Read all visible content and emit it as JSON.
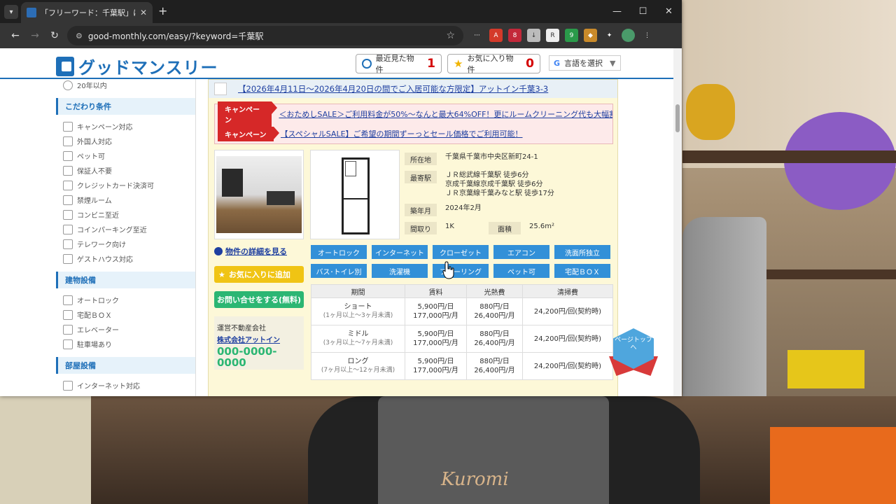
{
  "browser": {
    "tab_title": "「フリーワード：千葉駅」に該当した",
    "url": "good-monthly.com/easy/?keyword=千葉駅",
    "extensions": [
      "···",
      "A",
      "8",
      "↓",
      "R",
      "9",
      "◆",
      "✦"
    ]
  },
  "header": {
    "logo_text": "グッドマンスリー",
    "recent_label": "最近見た物件",
    "recent_count": "1",
    "fav_label": "お気に入り物件",
    "fav_count": "0",
    "lang_label": "言語を選択"
  },
  "sidebar": {
    "radio_label": "20年以内",
    "sections": [
      {
        "title": "こだわり条件",
        "items": [
          "キャンペーン対応",
          "外国人対応",
          "ペット可",
          "保証人不要",
          "クレジットカード決済可",
          "禁煙ルーム",
          "コンビニ至近",
          "コインパーキング至近",
          "テレワーク向け",
          "ゲストハウス対応"
        ]
      },
      {
        "title": "建物設備",
        "items": [
          "オートロック",
          "宅配ＢＯＸ",
          "エレベーター",
          "駐車場あり"
        ]
      },
      {
        "title": "部屋設備",
        "items": [
          "インターネット対応"
        ]
      }
    ]
  },
  "property": {
    "title": "【2026年4月11日～2026年4月20日の間でご入居可能な方限定】アットイン千葉3-3",
    "campaigns": [
      {
        "tag": "キャンペーン",
        "text": "＜おためしSALE＞ご利用料金が50%～なんと最大64%OFF！更にルームクリーニング代も大幅割…"
      },
      {
        "tag": "キャンペーン",
        "text": "【スペシャルSALE】ご希望の期間ずーっとセール価格でご利用可能！"
      }
    ],
    "info": {
      "address_label": "所在地",
      "address": "千葉県千葉市中央区新町24-1",
      "station_label": "最寄駅",
      "stations": [
        "ＪＲ総武線千葉駅 徒歩6分",
        "京成千葉線京成千葉駅 徒歩6分",
        "ＪＲ京葉線千葉みなと駅 徒歩17分"
      ],
      "built_label": "築年月",
      "built": "2024年2月",
      "layout_label": "間取り",
      "layout": "1K",
      "area_label": "面積",
      "area": "25.6m²"
    },
    "detail_link": "物件の詳細を見る",
    "fav_button": "お気に入りに追加",
    "inquiry_button": "お問い合せをする(無料)",
    "agency_label": "運営不動産会社",
    "agency_name": "株式会社アットイン",
    "agency_tel": "000-0000-0000",
    "tags": [
      "オートロック",
      "インターネット",
      "クローゼット",
      "エアコン",
      "洗面所独立",
      "バス･トイレ別",
      "洗濯機",
      "フローリング",
      "ペット可",
      "宅配ＢＯＸ"
    ],
    "price_headers": [
      "期間",
      "賃料",
      "光熱費",
      "清掃費"
    ],
    "prices": [
      {
        "period": "ショート",
        "range": "(1ヶ月以上～3ヶ月未満)",
        "rent_day": "5,900円/日",
        "rent_month": "177,000円/月",
        "util_day": "880円/日",
        "util_month": "26,400円/月",
        "clean": "24,200円/回(契約時)"
      },
      {
        "period": "ミドル",
        "range": "(3ヶ月以上～7ヶ月未満)",
        "rent_day": "5,900円/日",
        "rent_month": "177,000円/月",
        "util_day": "880円/日",
        "util_month": "26,400円/月",
        "clean": "24,200円/回(契約時)"
      },
      {
        "period": "ロング",
        "range": "(7ヶ月以上～12ヶ月未満)",
        "rent_day": "5,900円/日",
        "rent_month": "177,000円/月",
        "util_day": "880円/日",
        "util_month": "26,400円/月",
        "clean": "24,200円/回(契約時)"
      }
    ],
    "page_top": "ページトップへ"
  },
  "background": {
    "apron_text": "Kuromi"
  }
}
